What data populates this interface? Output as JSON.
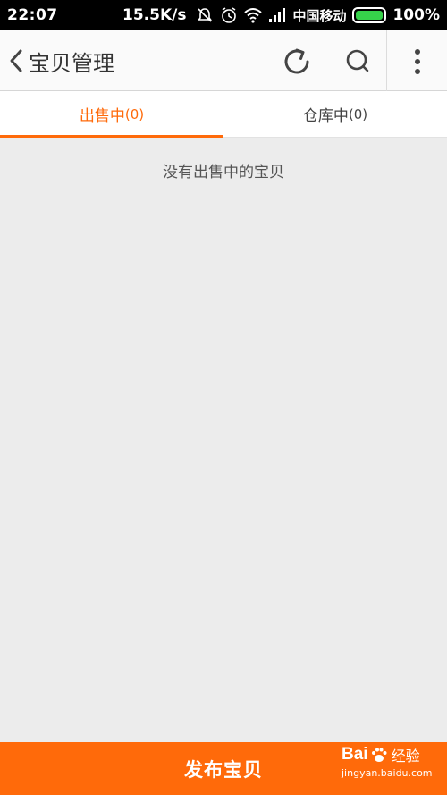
{
  "status_bar": {
    "time": "22:07",
    "speed": "15.5K/s",
    "carrier": "中国移动",
    "battery": "100%",
    "icons": [
      "mute-icon",
      "alarm-icon",
      "wifi-icon",
      "signal-icon",
      "battery-icon"
    ]
  },
  "header": {
    "title": "宝贝管理",
    "icons": [
      "back-arrow-icon",
      "refresh-icon",
      "search-icon",
      "more-vertical-icon"
    ]
  },
  "tabs": [
    {
      "label": "出售中",
      "count": "(0)",
      "active": true
    },
    {
      "label": "仓库中",
      "count": "(0)",
      "active": false
    }
  ],
  "content": {
    "empty_message": "没有出售中的宝贝"
  },
  "footer": {
    "publish_label": "发布宝贝"
  },
  "watermark": {
    "brand": "Bai",
    "brand2": "经验",
    "url": "jingyan.baidu.com"
  },
  "colors": {
    "accent": "#ff6a0a",
    "background": "#ececec",
    "status_bar": "#000000"
  }
}
